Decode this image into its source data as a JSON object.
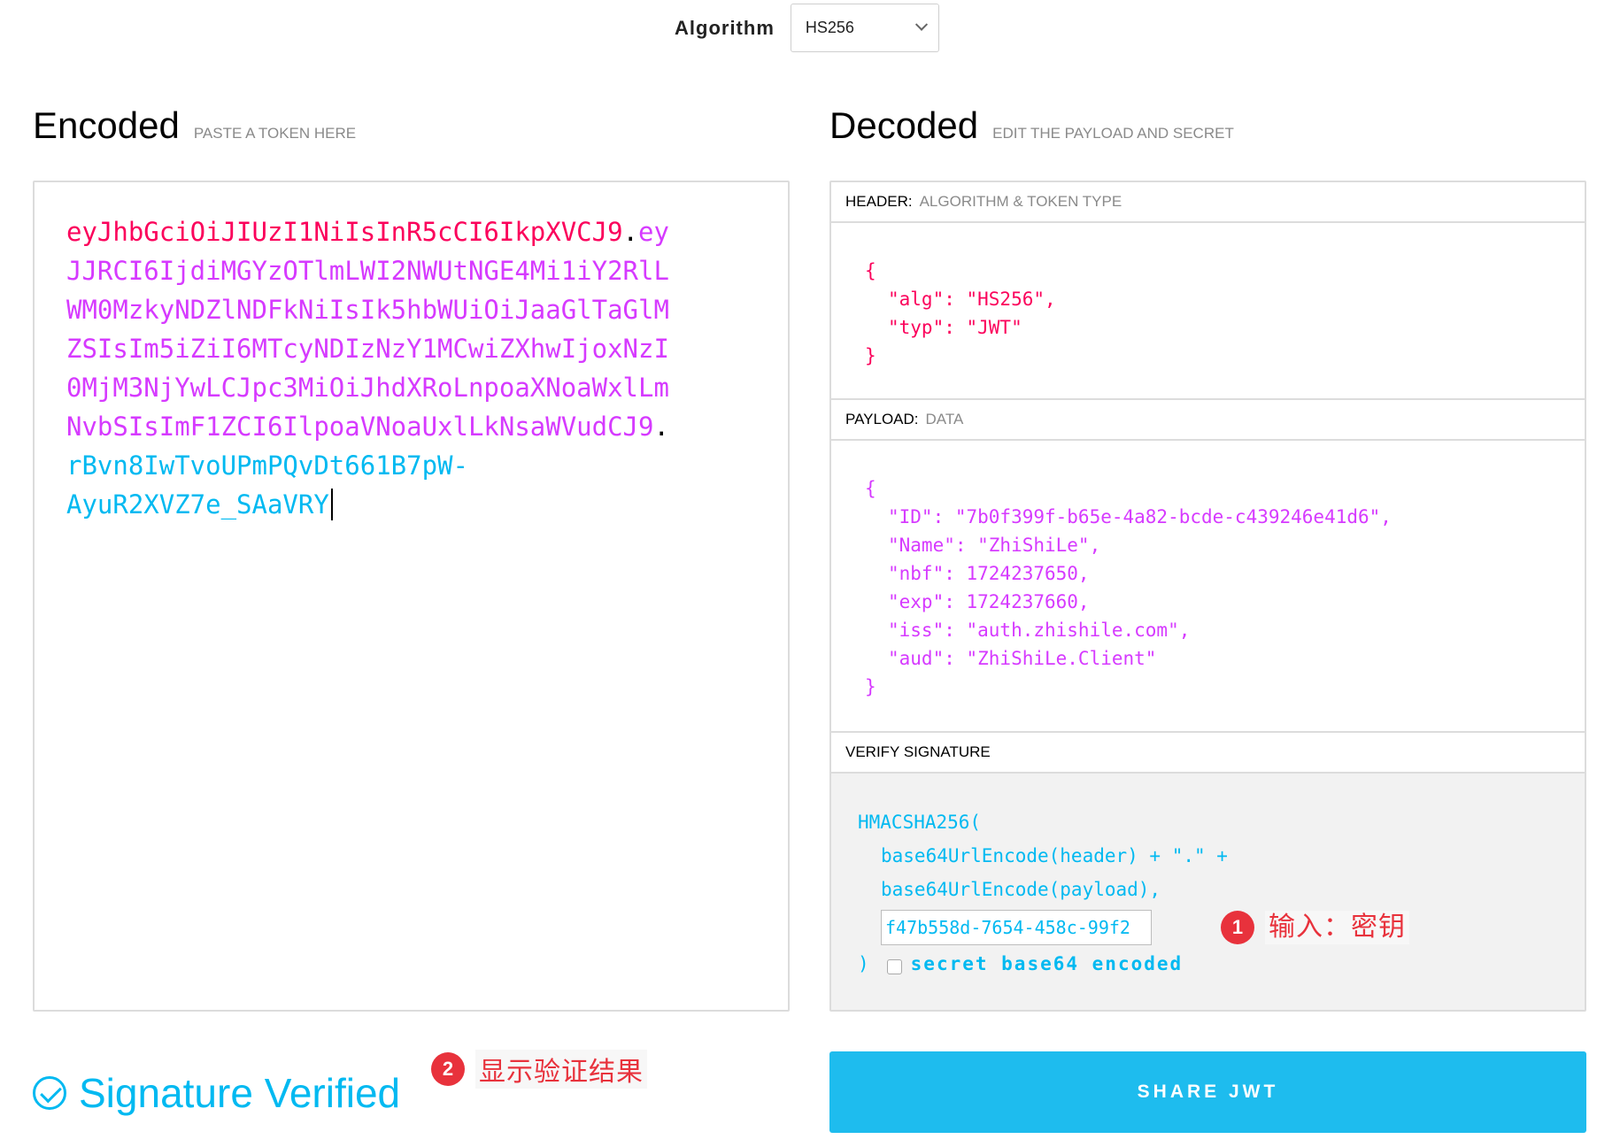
{
  "algorithm": {
    "label": "Algorithm",
    "selected": "HS256"
  },
  "encoded": {
    "title": "Encoded",
    "hint": "PASTE A TOKEN HERE",
    "lines": [
      [
        {
          "t": "eyJhbGciOiJIUzI1NiIsInR5cCI6IkpXVCJ9",
          "c": "red"
        },
        {
          "t": ".",
          "c": "black"
        },
        {
          "t": "ey",
          "c": "purple"
        }
      ],
      [
        {
          "t": "JJRCI6IjdiMGYzOTlmLWI2NWUtNGE4Mi1iY2RlL",
          "c": "purple"
        }
      ],
      [
        {
          "t": "WM0MzkyNDZlNDFkNiIsIk5hbWUiOiJaaGlTaGlM",
          "c": "purple"
        }
      ],
      [
        {
          "t": "ZSIsIm5iZiI6MTcyNDIzNzY1MCwiZXhwIjoxNzI",
          "c": "purple"
        }
      ],
      [
        {
          "t": "0MjM3NjYwLCJpc3MiOiJhdXRoLnpoaXNoaWxlLm",
          "c": "purple"
        }
      ],
      [
        {
          "t": "NvbSIsImF1ZCI6IlpoaVNoaUxlLkNsaWVudCJ9",
          "c": "purple"
        },
        {
          "t": ".",
          "c": "black"
        }
      ],
      [
        {
          "t": "rBvn8IwTvoUPmPQvDt661B7pW-",
          "c": "blue"
        }
      ],
      [
        {
          "t": "AyuR2XVZ7e_SAaVRY",
          "c": "blue"
        }
      ]
    ]
  },
  "decoded": {
    "title": "Decoded",
    "hint": "EDIT THE PAYLOAD AND SECRET",
    "header": {
      "label": "HEADER:",
      "sub": "ALGORITHM & TOKEN TYPE",
      "open": "{",
      "lines": [
        "\"alg\": \"HS256\",",
        "\"typ\": \"JWT\""
      ],
      "close": "}"
    },
    "payload": {
      "label": "PAYLOAD:",
      "sub": "DATA",
      "open": "{",
      "lines": [
        "\"ID\": \"7b0f399f-b65e-4a82-bcde-c439246e41d6\",",
        "\"Name\": \"ZhiShiLe\",",
        "\"nbf\": 1724237650,",
        "\"exp\": 1724237660,",
        "\"iss\": \"auth.zhishile.com\",",
        "\"aud\": \"ZhiShiLe.Client\""
      ],
      "close": "}"
    },
    "verify": {
      "label": "VERIFY SIGNATURE",
      "fn_open": "HMACSHA256(",
      "line1": "base64UrlEncode(header) + \".\" +",
      "line2": "base64UrlEncode(payload),",
      "secret_value": "f47b558d-7654-458c-99f2",
      "close": ")",
      "checkbox_label": "secret base64 encoded"
    }
  },
  "annotations": {
    "one": {
      "num": "1",
      "text": "输入：密钥"
    },
    "two": {
      "num": "2",
      "text": "显示验证结果"
    }
  },
  "status": {
    "text": "Signature Verified"
  },
  "share_button": {
    "label": "SHARE JWT"
  },
  "colors": {
    "header": "#fb015b",
    "payload": "#d63aff",
    "signature": "#00b9f1",
    "share": "#1ebcee",
    "annotation": "#e8323c"
  }
}
